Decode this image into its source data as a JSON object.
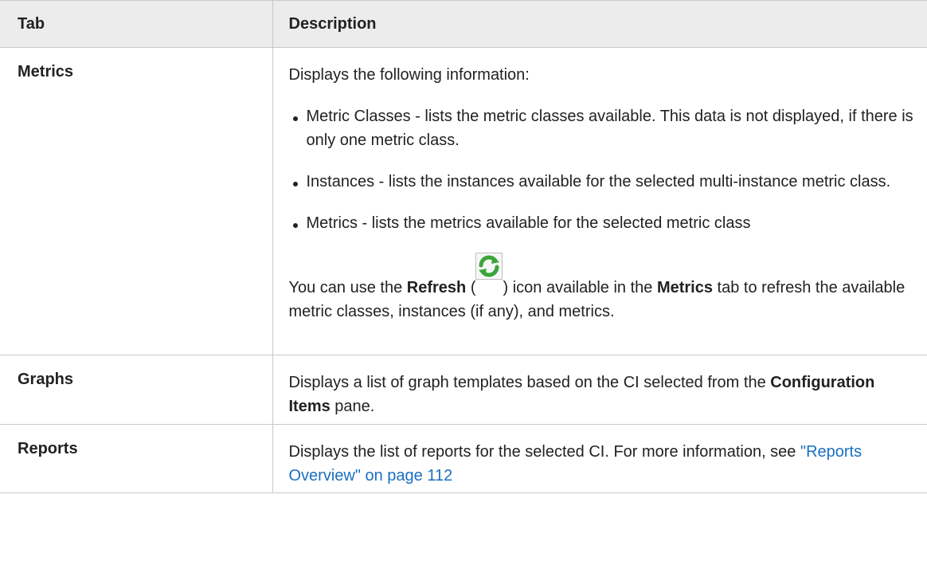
{
  "table": {
    "headers": {
      "tab": "Tab",
      "description": "Description"
    },
    "rows": {
      "metrics": {
        "tab": "Metrics",
        "intro": "Displays the following information:",
        "bullets": [
          "Metric Classes - lists the metric classes available. This data is not displayed, if there is only one metric class.",
          "Instances - lists the instances available for the selected multi-instance metric class.",
          "Metrics - lists the metrics available for the selected metric class"
        ],
        "note": {
          "part1": "You can use the ",
          "refresh": "Refresh",
          "part2": " (",
          "part3": ") icon available in the ",
          "metrics": "Metrics",
          "part4": " tab to refresh the available metric classes, instances (if any), and metrics.",
          "icon": "refresh-icon"
        }
      },
      "graphs": {
        "tab": "Graphs",
        "part1": "Displays a list of graph templates based on the CI selected from the ",
        "bold": "Configuration Items",
        "part2": " pane."
      },
      "reports": {
        "tab": "Reports",
        "part1": "Displays the list of reports for the selected CI. For more information, see ",
        "link": "\"Reports Overview\" on page 112"
      }
    },
    "colors": {
      "header_bg": "#ececec",
      "border": "#c8c8c8",
      "link": "#1a6fc0",
      "icon_green": "#3aa53a"
    }
  }
}
